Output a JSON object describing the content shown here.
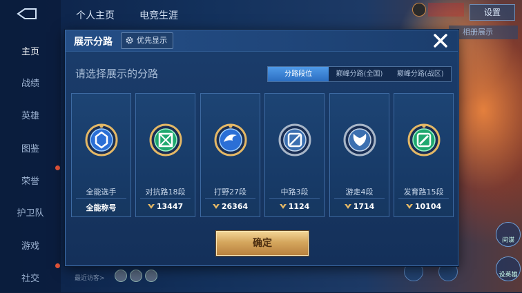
{
  "background": {
    "top_tabs": [
      "个人主页",
      "电竞生涯"
    ],
    "top_right_label": "设置",
    "behind_button_label": "相册展示",
    "side_nav": [
      {
        "label": "主页",
        "active": true
      },
      {
        "label": "战绩",
        "active": false
      },
      {
        "label": "英雄",
        "active": false
      },
      {
        "label": "图鉴",
        "active": false
      },
      {
        "label": "荣誉",
        "active": false
      },
      {
        "label": "护卫队",
        "active": false
      },
      {
        "label": "游戏",
        "active": false
      },
      {
        "label": "社交",
        "active": false
      }
    ],
    "recent_visitors_label": "最近访客>",
    "right_buttons": [
      "间谍",
      "设英雄"
    ]
  },
  "modal": {
    "title": "展示分路",
    "priority_button": "优先显示",
    "prompt": "请选择展示的分路",
    "segments": [
      {
        "label": "分路段位",
        "active": true
      },
      {
        "label": "巅峰分路(全国)",
        "active": false
      },
      {
        "label": "巅峰分路(战区)",
        "active": false
      }
    ],
    "cards": [
      {
        "name": "全能选手",
        "score": "全能称号",
        "has_coin": false,
        "emblem": "allround-emblem-icon",
        "accent": "#3a8cf0"
      },
      {
        "name": "对抗路18段",
        "score": "13447",
        "has_coin": true,
        "emblem": "clash-lane-emblem-icon",
        "accent": "#2fd08a"
      },
      {
        "name": "打野27段",
        "score": "26364",
        "has_coin": true,
        "emblem": "jungle-emblem-icon",
        "accent": "#3a8cf0"
      },
      {
        "name": "中路3段",
        "score": "1124",
        "has_coin": true,
        "emblem": "mid-lane-emblem-icon",
        "accent": "#a8b6c8"
      },
      {
        "name": "游走4段",
        "score": "1714",
        "has_coin": true,
        "emblem": "roam-emblem-icon",
        "accent": "#a8b6c8"
      },
      {
        "name": "发育路15段",
        "score": "10104",
        "has_coin": true,
        "emblem": "farm-lane-emblem-icon",
        "accent": "#2fd08a"
      }
    ],
    "confirm_label": "确定"
  },
  "colors": {
    "gold": "#e4b866",
    "active_segment": "#3b85d8"
  }
}
